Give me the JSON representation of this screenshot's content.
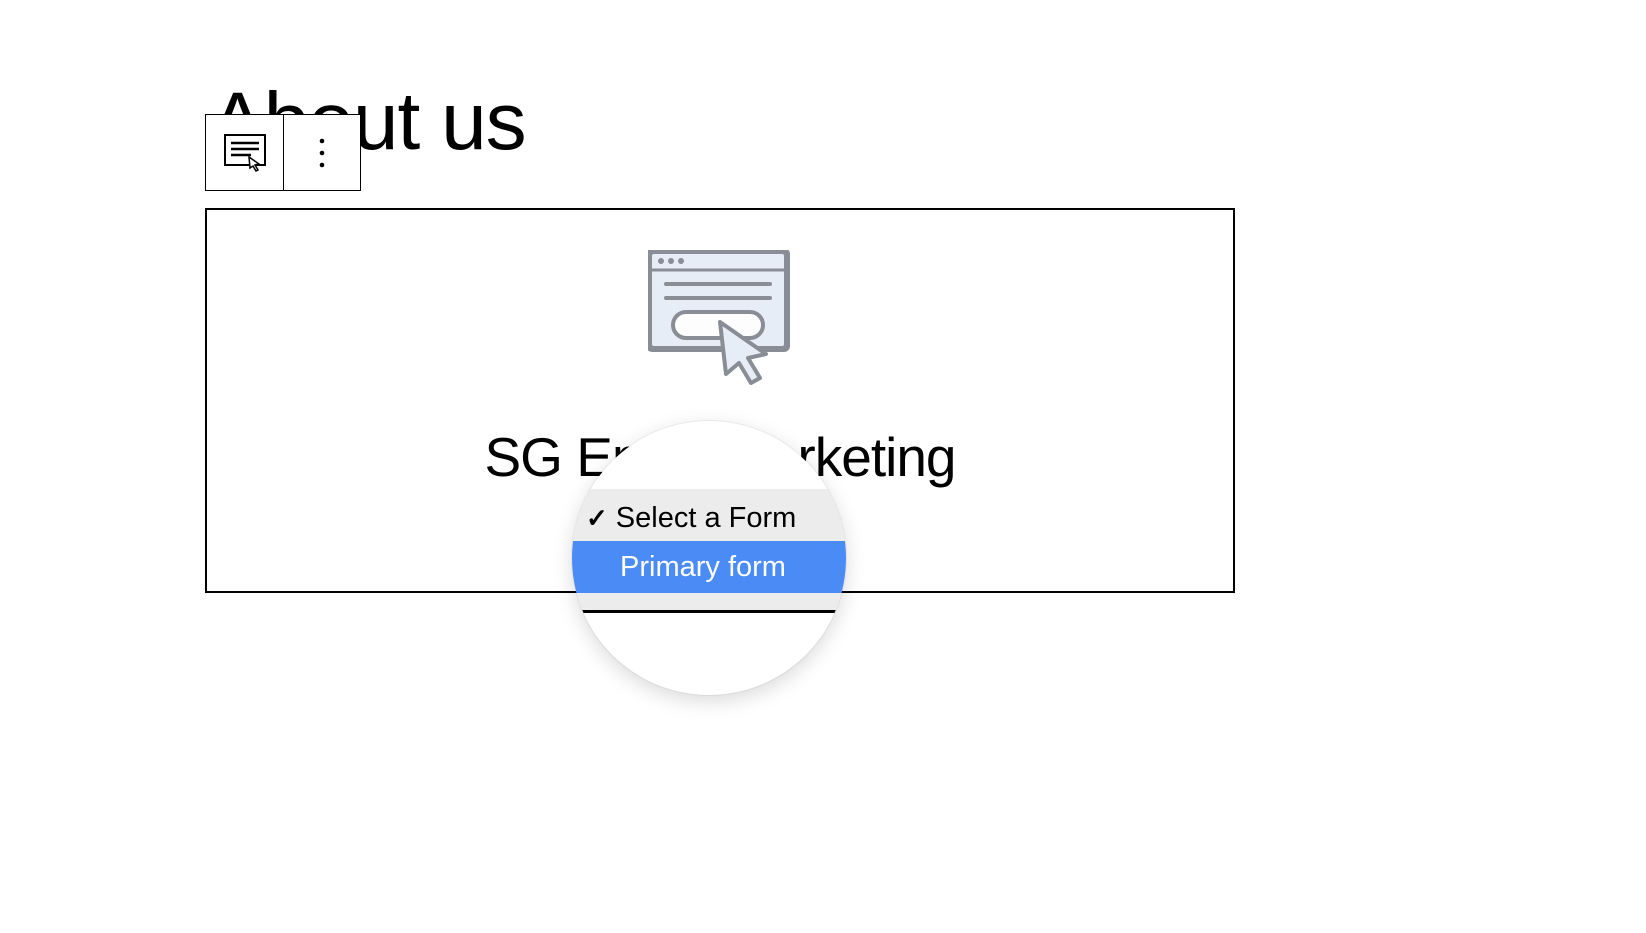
{
  "page": {
    "title": "About us"
  },
  "block": {
    "title": "SG Email Marketing"
  },
  "dropdown": {
    "selected_label": "Select a Form",
    "highlighted_label": "Primary form"
  },
  "colors": {
    "highlight": "#4b8bf5",
    "border": "#000000",
    "illustration_fill": "#e6edf7",
    "illustration_stroke": "#888d96"
  }
}
